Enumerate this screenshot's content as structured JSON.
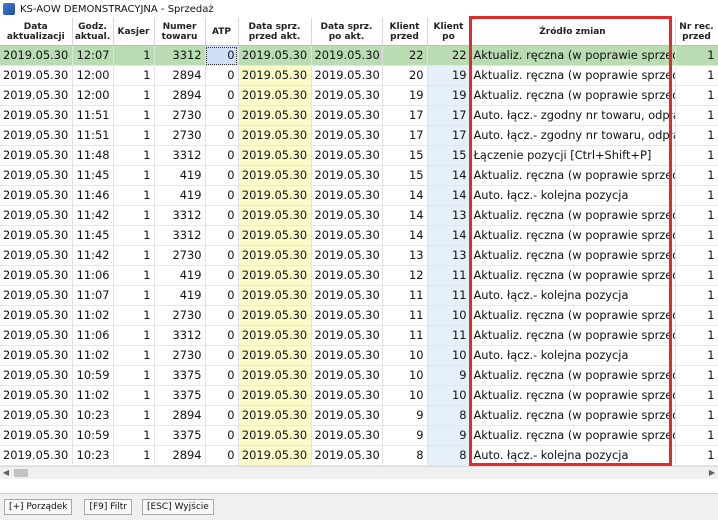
{
  "window": {
    "title": "KS-AOW DEMONSTRACYJNA - Sprzedaż"
  },
  "columns": [
    {
      "line1": "Data",
      "line2": "aktualizacji"
    },
    {
      "line1": "Godz.",
      "line2": "aktual."
    },
    {
      "line1": "Kasjer",
      "line2": ""
    },
    {
      "line1": "Numer",
      "line2": "towaru"
    },
    {
      "line1": "ATP",
      "line2": ""
    },
    {
      "line1": "Data sprz.",
      "line2": "przed akt."
    },
    {
      "line1": "Data sprz.",
      "line2": "po akt."
    },
    {
      "line1": "Klient",
      "line2": "przed"
    },
    {
      "line1": "Klient",
      "line2": "po"
    },
    {
      "line1": "Źródło zmian",
      "line2": ""
    },
    {
      "line1": "Nr rec.",
      "line2": "przed"
    }
  ],
  "rows": [
    {
      "date": "2019.05.30",
      "time": "12:07",
      "cashier": "1",
      "item": "3312",
      "atp": "0",
      "sale_before": "2019.05.30",
      "sale_after": "2019.05.30",
      "client_before": "22",
      "client_after": "22",
      "source": "Aktualiz. ręczna (w poprawie sprzedaży)",
      "rec": "1"
    },
    {
      "date": "2019.05.30",
      "time": "12:00",
      "cashier": "1",
      "item": "2894",
      "atp": "0",
      "sale_before": "2019.05.30",
      "sale_after": "2019.05.30",
      "client_before": "20",
      "client_after": "19",
      "source": "Aktualiz. ręczna (w poprawie sprzedaży)",
      "rec": "1"
    },
    {
      "date": "2019.05.30",
      "time": "12:00",
      "cashier": "1",
      "item": "2894",
      "atp": "0",
      "sale_before": "2019.05.30",
      "sale_after": "2019.05.30",
      "client_before": "19",
      "client_after": "19",
      "source": "Aktualiz. ręczna (w poprawie sprzedaży)",
      "rec": "1"
    },
    {
      "date": "2019.05.30",
      "time": "11:51",
      "cashier": "1",
      "item": "2730",
      "atp": "0",
      "sale_before": "2019.05.30",
      "sale_after": "2019.05.30",
      "client_before": "17",
      "client_after": "17",
      "source": "Auto. łącz.- zgodny nr towaru, odpłatność",
      "rec": "1"
    },
    {
      "date": "2019.05.30",
      "time": "11:51",
      "cashier": "1",
      "item": "2730",
      "atp": "0",
      "sale_before": "2019.05.30",
      "sale_after": "2019.05.30",
      "client_before": "17",
      "client_after": "17",
      "source": "Auto. łącz.- zgodny nr towaru, odpłatność",
      "rec": "1"
    },
    {
      "date": "2019.05.30",
      "time": "11:48",
      "cashier": "1",
      "item": "3312",
      "atp": "0",
      "sale_before": "2019.05.30",
      "sale_after": "2019.05.30",
      "client_before": "15",
      "client_after": "15",
      "source": "Łączenie pozycji [Ctrl+Shift+P]",
      "rec": "1"
    },
    {
      "date": "2019.05.30",
      "time": "11:45",
      "cashier": "1",
      "item": "419",
      "atp": "0",
      "sale_before": "2019.05.30",
      "sale_after": "2019.05.30",
      "client_before": "15",
      "client_after": "14",
      "source": "Aktualiz. ręczna (w poprawie sprzedaży)",
      "rec": "1"
    },
    {
      "date": "2019.05.30",
      "time": "11:46",
      "cashier": "1",
      "item": "419",
      "atp": "0",
      "sale_before": "2019.05.30",
      "sale_after": "2019.05.30",
      "client_before": "14",
      "client_after": "14",
      "source": "Auto. łącz.- kolejna pozycja",
      "rec": "1"
    },
    {
      "date": "2019.05.30",
      "time": "11:42",
      "cashier": "1",
      "item": "3312",
      "atp": "0",
      "sale_before": "2019.05.30",
      "sale_after": "2019.05.30",
      "client_before": "14",
      "client_after": "13",
      "source": "Aktualiz. ręczna (w poprawie sprzedaży)",
      "rec": "1"
    },
    {
      "date": "2019.05.30",
      "time": "11:45",
      "cashier": "1",
      "item": "3312",
      "atp": "0",
      "sale_before": "2019.05.30",
      "sale_after": "2019.05.30",
      "client_before": "14",
      "client_after": "14",
      "source": "Aktualiz. ręczna (w poprawie sprzedaży)",
      "rec": "1"
    },
    {
      "date": "2019.05.30",
      "time": "11:42",
      "cashier": "1",
      "item": "2730",
      "atp": "0",
      "sale_before": "2019.05.30",
      "sale_after": "2019.05.30",
      "client_before": "13",
      "client_after": "13",
      "source": "Aktualiz. ręczna (w poprawie sprzedaży)",
      "rec": "1"
    },
    {
      "date": "2019.05.30",
      "time": "11:06",
      "cashier": "1",
      "item": "419",
      "atp": "0",
      "sale_before": "2019.05.30",
      "sale_after": "2019.05.30",
      "client_before": "12",
      "client_after": "11",
      "source": "Aktualiz. ręczna (w poprawie sprzedaży)",
      "rec": "1"
    },
    {
      "date": "2019.05.30",
      "time": "11:07",
      "cashier": "1",
      "item": "419",
      "atp": "0",
      "sale_before": "2019.05.30",
      "sale_after": "2019.05.30",
      "client_before": "11",
      "client_after": "11",
      "source": "Auto. łącz.- kolejna pozycja",
      "rec": "1"
    },
    {
      "date": "2019.05.30",
      "time": "11:02",
      "cashier": "1",
      "item": "2730",
      "atp": "0",
      "sale_before": "2019.05.30",
      "sale_after": "2019.05.30",
      "client_before": "11",
      "client_after": "10",
      "source": "Aktualiz. ręczna (w poprawie sprzedaży)",
      "rec": "1"
    },
    {
      "date": "2019.05.30",
      "time": "11:06",
      "cashier": "1",
      "item": "3312",
      "atp": "0",
      "sale_before": "2019.05.30",
      "sale_after": "2019.05.30",
      "client_before": "11",
      "client_after": "11",
      "source": "Aktualiz. ręczna (w poprawie sprzedaży)",
      "rec": "1"
    },
    {
      "date": "2019.05.30",
      "time": "11:02",
      "cashier": "1",
      "item": "2730",
      "atp": "0",
      "sale_before": "2019.05.30",
      "sale_after": "2019.05.30",
      "client_before": "10",
      "client_after": "10",
      "source": "Auto. łącz.- kolejna pozycja",
      "rec": "1"
    },
    {
      "date": "2019.05.30",
      "time": "10:59",
      "cashier": "1",
      "item": "3375",
      "atp": "0",
      "sale_before": "2019.05.30",
      "sale_after": "2019.05.30",
      "client_before": "10",
      "client_after": "9",
      "source": "Aktualiz. ręczna (w poprawie sprzedaży)",
      "rec": "1"
    },
    {
      "date": "2019.05.30",
      "time": "11:02",
      "cashier": "1",
      "item": "3375",
      "atp": "0",
      "sale_before": "2019.05.30",
      "sale_after": "2019.05.30",
      "client_before": "10",
      "client_after": "10",
      "source": "Aktualiz. ręczna (w poprawie sprzedaży)",
      "rec": "1"
    },
    {
      "date": "2019.05.30",
      "time": "10:23",
      "cashier": "1",
      "item": "2894",
      "atp": "0",
      "sale_before": "2019.05.30",
      "sale_after": "2019.05.30",
      "client_before": "9",
      "client_after": "8",
      "source": "Aktualiz. ręczna (w poprawie sprzedaży)",
      "rec": "1"
    },
    {
      "date": "2019.05.30",
      "time": "10:59",
      "cashier": "1",
      "item": "3375",
      "atp": "0",
      "sale_before": "2019.05.30",
      "sale_after": "2019.05.30",
      "client_before": "9",
      "client_after": "9",
      "source": "Aktualiz. ręczna (w poprawie sprzedaży)",
      "rec": "1"
    },
    {
      "date": "2019.05.30",
      "time": "10:23",
      "cashier": "1",
      "item": "2894",
      "atp": "0",
      "sale_before": "2019.05.30",
      "sale_after": "2019.05.30",
      "client_before": "8",
      "client_after": "8",
      "source": "Auto. łącz.- kolejna pozycja",
      "rec": "1"
    }
  ],
  "selected_row": 0,
  "highlighted_column": "Źródło zmian",
  "status_buttons": [
    {
      "label": "[+] Porządek"
    },
    {
      "label": "[F9] Filtr"
    },
    {
      "label": "[ESC] Wyjście"
    }
  ],
  "colors": {
    "selected_row": "#b9dcb3",
    "sale_before_bg": "#fcfac9",
    "client_after_bg": "#e5f0fb",
    "changed_value": "#1a3fb5",
    "highlight_frame": "#e02b2b"
  },
  "icons": {
    "window": "app-icon",
    "scroll_left": "left-arrow-icon",
    "scroll_right": "right-arrow-icon"
  }
}
